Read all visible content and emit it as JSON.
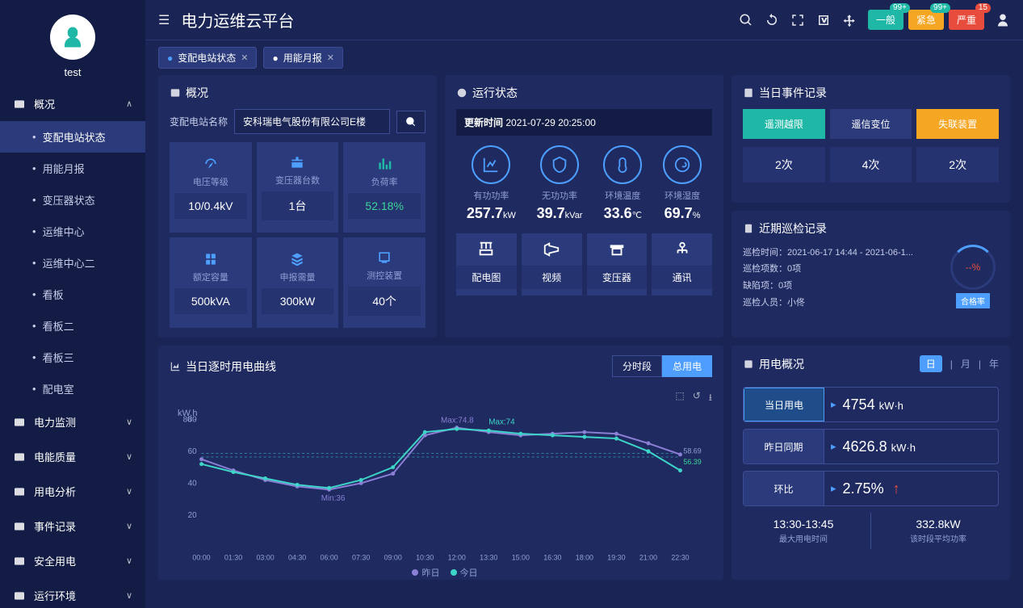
{
  "app_title": "电力运维云平台",
  "user": "test",
  "top_alerts": [
    {
      "label": "一般",
      "badge": "99+",
      "cls": "g"
    },
    {
      "label": "紧急",
      "badge": "99+",
      "cls": "o"
    },
    {
      "label": "严重",
      "badge": "15",
      "cls": "r"
    }
  ],
  "tabs": [
    {
      "label": "变配电站状态",
      "active": true
    },
    {
      "label": "用能月报",
      "active": false
    }
  ],
  "sidebar": {
    "groups": [
      {
        "label": "概况",
        "expanded": true,
        "items": [
          "变配电站状态",
          "用能月报",
          "变压器状态",
          "运维中心",
          "运维中心二",
          "看板",
          "看板二",
          "看板三",
          "配电室"
        ],
        "active_index": 0
      },
      {
        "label": "电力监测",
        "expanded": false
      },
      {
        "label": "电能质量",
        "expanded": false
      },
      {
        "label": "用电分析",
        "expanded": false
      },
      {
        "label": "事件记录",
        "expanded": false
      },
      {
        "label": "安全用电",
        "expanded": false
      },
      {
        "label": "运行环境",
        "expanded": false
      }
    ]
  },
  "overview": {
    "title": "概况",
    "search_label": "变配电站名称",
    "station": "安科瑞电气股份有限公司E楼",
    "cards": [
      {
        "label": "电压等级",
        "value": "10/0.4kV"
      },
      {
        "label": "变压器台数",
        "value": "1台"
      },
      {
        "label": "负荷率",
        "value": "52.18%",
        "green": true
      },
      {
        "label": "额定容量",
        "value": "500kVA"
      },
      {
        "label": "申报需量",
        "value": "300kW"
      },
      {
        "label": "测控装置",
        "value": "40个"
      }
    ]
  },
  "runtime": {
    "title": "运行状态",
    "update_label": "更新时间",
    "update_time": "2021-07-29 20:25:00",
    "gauges": [
      {
        "label": "有功功率",
        "value": "257.7",
        "unit": "kW"
      },
      {
        "label": "无功功率",
        "value": "39.7",
        "unit": "kVar"
      },
      {
        "label": "环境温度",
        "value": "33.6",
        "unit": "℃"
      },
      {
        "label": "环境湿度",
        "value": "69.7",
        "unit": "%"
      }
    ],
    "buttons": [
      "配电图",
      "视频",
      "变压器",
      "通讯"
    ]
  },
  "events": {
    "title": "当日事件记录",
    "tabs": [
      "遥测越限",
      "遥信变位",
      "失联装置"
    ],
    "counts": [
      "2次",
      "4次",
      "2次"
    ]
  },
  "inspection": {
    "title": "近期巡检记录",
    "lines": {
      "time_label": "巡检时间：",
      "time_value": "2021-06-17 14:44 - 2021-06-1...",
      "items_label": "巡检项数：",
      "items_value": "0项",
      "defect_label": "缺陷项：",
      "defect_value": "0项",
      "person_label": "巡检人员：",
      "person_value": "小佟"
    },
    "pass_rate": "--%",
    "pass_label": "合格率"
  },
  "chart": {
    "title": "当日逐时用电曲线",
    "seg": [
      "分时段",
      "总用电"
    ],
    "seg_active": 1,
    "y_unit": "kW.h",
    "legend": [
      "昨日",
      "今日"
    ],
    "max1": "Max:74.8",
    "max2": "Max:74",
    "min1": "Min:36",
    "ref1": "58.69",
    "ref2": "56.39"
  },
  "chart_data": {
    "type": "line",
    "x": [
      "00:00",
      "01:30",
      "03:00",
      "04:30",
      "06:00",
      "07:30",
      "09:00",
      "10:30",
      "12:00",
      "13:30",
      "15:00",
      "16:30",
      "18:00",
      "19:30",
      "21:00",
      "22:30"
    ],
    "series": [
      {
        "name": "昨日",
        "values": [
          55,
          48,
          42,
          38,
          36,
          40,
          46,
          70,
          74.8,
          72,
          70,
          71,
          72,
          71,
          65,
          58
        ]
      },
      {
        "name": "今日",
        "values": [
          52,
          47,
          43,
          39,
          37,
          42,
          50,
          72,
          74,
          73,
          71,
          70,
          69,
          68,
          60,
          48
        ]
      }
    ],
    "ylim": [
      0,
      80
    ],
    "ylabel": "kW.h",
    "annotations": {
      "max_yesterday": 74.8,
      "max_today": 74,
      "min_yesterday": 36,
      "ref_lines": [
        58.69,
        56.39
      ]
    }
  },
  "usage": {
    "title": "用电概况",
    "periods": [
      "日",
      "月",
      "年"
    ],
    "period_active": 0,
    "cards": [
      {
        "label": "当日用电",
        "value": "4754",
        "unit": "kW·h",
        "active": true
      },
      {
        "label": "昨日同期",
        "value": "4626.8",
        "unit": "kW·h"
      },
      {
        "label": "环比",
        "value": "2.75%",
        "trend": "up"
      }
    ],
    "bottom": [
      {
        "value": "13:30-13:45",
        "label": "最大用电时间"
      },
      {
        "value": "332.8kW",
        "label": "该时段平均功率"
      }
    ]
  }
}
